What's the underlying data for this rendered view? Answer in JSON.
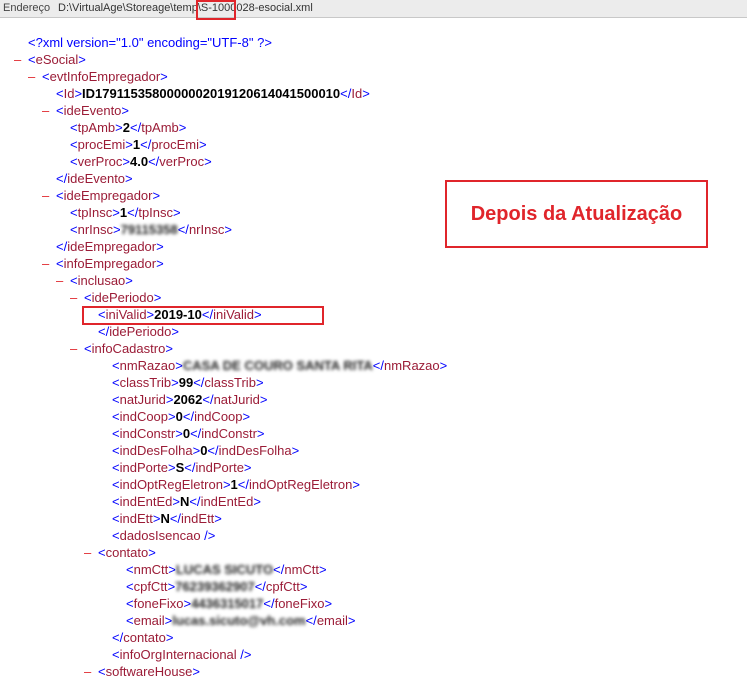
{
  "address_bar": {
    "label": "Endereço",
    "path": "D:\\VirtualAge\\Storeage\\temp\\S-1000028-esocial.xml"
  },
  "callout_text": "Depois da Atualização",
  "xml_declaration": "<?xml version=\"1.0\" encoding=\"UTF-8\" ?>",
  "collapse_glyph": "–",
  "lines": [
    {
      "indent": 0,
      "collapsible": true,
      "open": "eSocial"
    },
    {
      "indent": 1,
      "collapsible": true,
      "open": "evtInfoEmpregador"
    },
    {
      "indent": 2,
      "collapsible": false,
      "open": "Id",
      "value": "ID1791153580000002019120614041500010",
      "close": "Id"
    },
    {
      "indent": 2,
      "collapsible": true,
      "open": "ideEvento"
    },
    {
      "indent": 3,
      "collapsible": false,
      "open": "tpAmb",
      "value": "2",
      "close": "tpAmb"
    },
    {
      "indent": 3,
      "collapsible": false,
      "open": "procEmi",
      "value": "1",
      "close": "procEmi"
    },
    {
      "indent": 3,
      "collapsible": false,
      "open": "verProc",
      "value": "4.0",
      "close": "verProc"
    },
    {
      "indent": 2,
      "collapsible": false,
      "end": "ideEvento"
    },
    {
      "indent": 2,
      "collapsible": true,
      "open": "ideEmpregador"
    },
    {
      "indent": 3,
      "collapsible": false,
      "open": "tpInsc",
      "value": "1",
      "close": "tpInsc"
    },
    {
      "indent": 3,
      "collapsible": false,
      "open": "nrInsc",
      "value": "79115358",
      "close": "nrInsc",
      "blurred": true
    },
    {
      "indent": 2,
      "collapsible": false,
      "end": "ideEmpregador"
    },
    {
      "indent": 2,
      "collapsible": true,
      "open": "infoEmpregador"
    },
    {
      "indent": 3,
      "collapsible": true,
      "open": "inclusao"
    },
    {
      "indent": 4,
      "collapsible": true,
      "open": "idePeriodo"
    },
    {
      "indent": 5,
      "collapsible": false,
      "open": "iniValid",
      "value": "2019-10",
      "close": "iniValid"
    },
    {
      "indent": 5,
      "collapsible": false,
      "end": "idePeriodo"
    },
    {
      "indent": 4,
      "collapsible": true,
      "open": "infoCadastro"
    },
    {
      "indent": 6,
      "collapsible": false,
      "open": "nmRazao",
      "value": "CASA DE COURO SANTA RITA",
      "close": "nmRazao",
      "blurred": true
    },
    {
      "indent": 6,
      "collapsible": false,
      "open": "classTrib",
      "value": "99",
      "close": "classTrib"
    },
    {
      "indent": 6,
      "collapsible": false,
      "open": "natJurid",
      "value": "2062",
      "close": "natJurid"
    },
    {
      "indent": 6,
      "collapsible": false,
      "open": "indCoop",
      "value": "0",
      "close": "indCoop"
    },
    {
      "indent": 6,
      "collapsible": false,
      "open": "indConstr",
      "value": "0",
      "close": "indConstr"
    },
    {
      "indent": 6,
      "collapsible": false,
      "open": "indDesFolha",
      "value": "0",
      "close": "indDesFolha"
    },
    {
      "indent": 6,
      "collapsible": false,
      "open": "indPorte",
      "value": "S",
      "close": "indPorte"
    },
    {
      "indent": 6,
      "collapsible": false,
      "open": "indOptRegEletron",
      "value": "1",
      "close": "indOptRegEletron"
    },
    {
      "indent": 6,
      "collapsible": false,
      "open": "indEntEd",
      "value": "N",
      "close": "indEntEd"
    },
    {
      "indent": 6,
      "collapsible": false,
      "open": "indEtt",
      "value": "N",
      "close": "indEtt"
    },
    {
      "indent": 6,
      "collapsible": false,
      "selfclose": "dadosIsencao"
    },
    {
      "indent": 5,
      "collapsible": true,
      "open": "contato"
    },
    {
      "indent": 7,
      "collapsible": false,
      "open": "nmCtt",
      "value": "LUCAS SICUTO",
      "close": "nmCtt",
      "blurred": true
    },
    {
      "indent": 7,
      "collapsible": false,
      "open": "cpfCtt",
      "value": "76239362907",
      "close": "cpfCtt",
      "blurred": true
    },
    {
      "indent": 7,
      "collapsible": false,
      "open": "foneFixo",
      "value": "4436315017",
      "close": "foneFixo",
      "blurred": true
    },
    {
      "indent": 7,
      "collapsible": false,
      "open": "email",
      "value": "lucas.sicuto@vh.com",
      "close": "email",
      "blurred": true
    },
    {
      "indent": 6,
      "collapsible": false,
      "end": "contato"
    },
    {
      "indent": 6,
      "collapsible": false,
      "selfclose": "infoOrgInternacional"
    },
    {
      "indent": 5,
      "collapsible": true,
      "open": "softwareHouse"
    }
  ]
}
